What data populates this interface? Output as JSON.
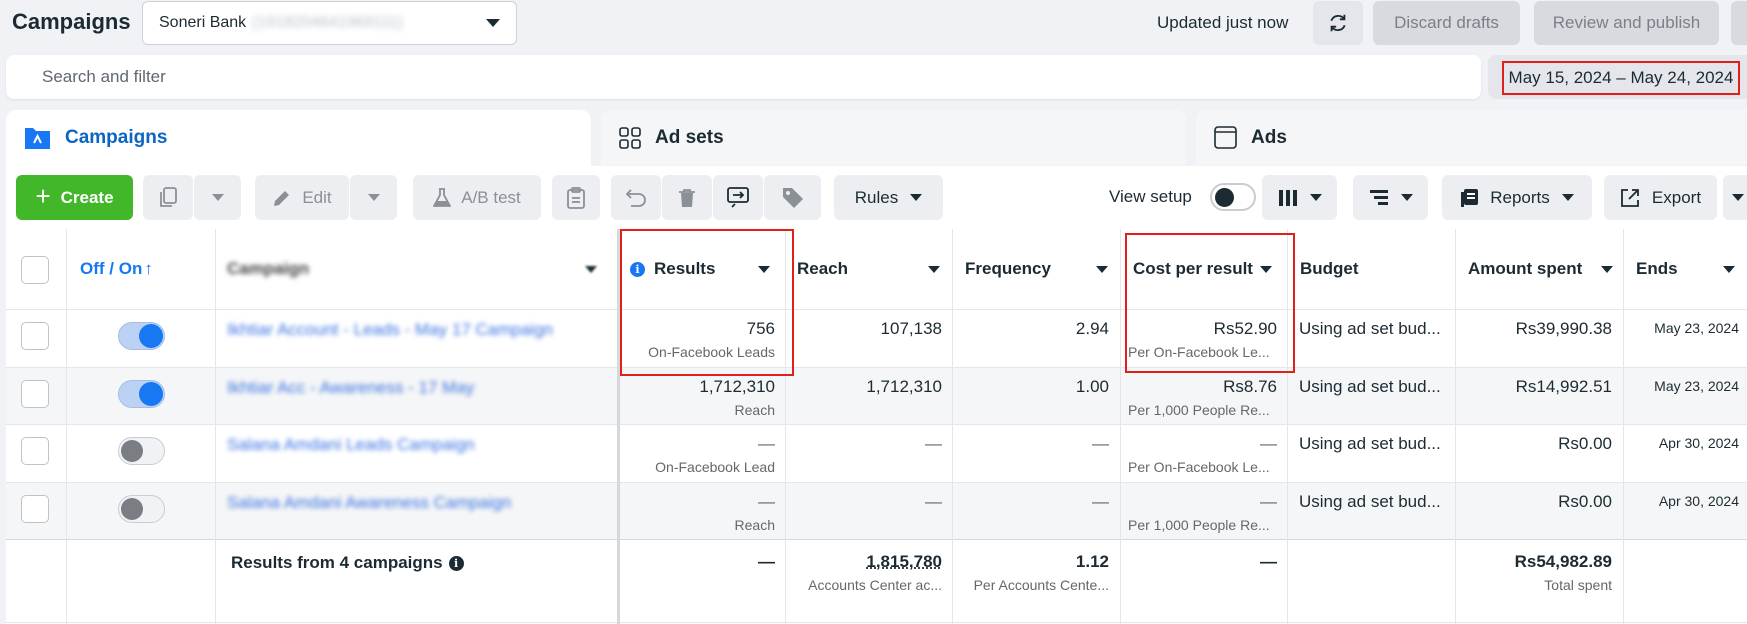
{
  "header": {
    "title": "Campaigns",
    "account_name": "Soneri Bank",
    "account_id": "(1918204641969111)",
    "updated_text": "Updated just now",
    "discard_label": "Discard drafts",
    "review_label": "Review and publish"
  },
  "search": {
    "placeholder": "Search and filter",
    "date_range": "May 15, 2024 – May 24, 2024"
  },
  "tabs": [
    {
      "label": "Campaigns"
    },
    {
      "label": "Ad sets"
    },
    {
      "label": "Ads"
    }
  ],
  "toolbar": {
    "create_label": "Create",
    "edit_label": "Edit",
    "ab_test_label": "A/B test",
    "rules_label": "Rules",
    "view_setup_label": "View setup",
    "reports_label": "Reports",
    "export_label": "Export"
  },
  "table": {
    "columns": {
      "off_on": "Off / On",
      "campaign": "Campaign",
      "results": "Results",
      "reach": "Reach",
      "frequency": "Frequency",
      "cost_per_result": "Cost per result",
      "budget": "Budget",
      "amount_spent": "Amount spent",
      "ends": "Ends"
    },
    "rows": [
      {
        "campaign": "Ikhtiar Account - Leads - May 17 Campaign",
        "on": true,
        "results": "756",
        "results_sub": "On-Facebook Leads",
        "reach": "107,138",
        "frequency": "2.94",
        "cost": "Rs52.90",
        "cost_sub": "Per On-Facebook Le...",
        "budget": "Using ad set bud...",
        "amount": "Rs39,990.38",
        "ends": "May 23, 2024"
      },
      {
        "campaign": "Ikhtiar Acc - Awareness - 17 May",
        "on": true,
        "results": "1,712,310",
        "results_sub": "Reach",
        "reach": "1,712,310",
        "frequency": "1.00",
        "cost": "Rs8.76",
        "cost_sub": "Per 1,000 People Re...",
        "budget": "Using ad set bud...",
        "amount": "Rs14,992.51",
        "ends": "May 23, 2024"
      },
      {
        "campaign": "Salana Amdani Leads Campaign",
        "on": false,
        "results": "—",
        "results_sub": "On-Facebook Lead",
        "reach": "—",
        "frequency": "—",
        "cost": "—",
        "cost_sub": "Per On-Facebook Le...",
        "budget": "Using ad set bud...",
        "amount": "Rs0.00",
        "ends": "Apr 30, 2024"
      },
      {
        "campaign": "Salana Amdani Awareness Campaign",
        "on": false,
        "results": "—",
        "results_sub": "Reach",
        "reach": "—",
        "frequency": "—",
        "cost": "—",
        "cost_sub": "Per 1,000 People Re...",
        "budget": "Using ad set bud...",
        "amount": "Rs0.00",
        "ends": "Apr 30, 2024"
      }
    ],
    "summary": {
      "label": "Results from 4 campaigns",
      "results": "—",
      "reach": "1,815,780",
      "reach_sub": "Accounts Center ac...",
      "frequency": "1.12",
      "frequency_sub": "Per Accounts Cente...",
      "cost": "—",
      "amount": "Rs54,982.89",
      "amount_sub": "Total spent"
    }
  },
  "colors": {
    "accent": "#0a66c2",
    "create_green": "#42b72a",
    "highlight_red": "#e0211b"
  }
}
